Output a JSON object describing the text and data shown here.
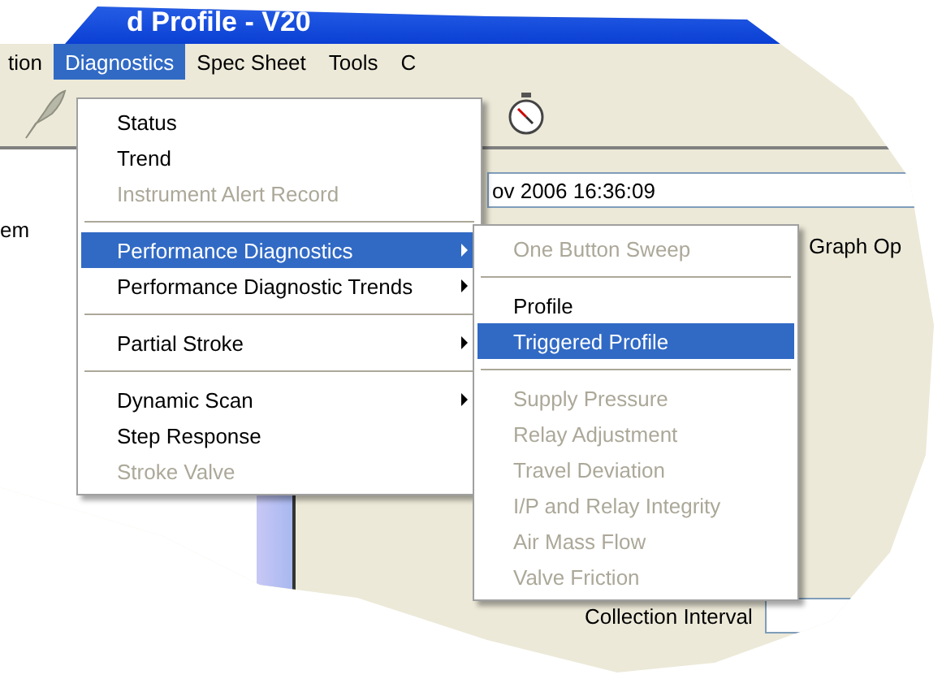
{
  "window": {
    "title": "d Profile - V20"
  },
  "menubar": [
    {
      "label": "tion",
      "selected": false
    },
    {
      "label": "Diagnostics",
      "selected": true
    },
    {
      "label": "Spec Sheet",
      "selected": false
    },
    {
      "label": "Tools",
      "selected": false
    },
    {
      "label": "C",
      "selected": false
    }
  ],
  "side_label": "em",
  "date_field": {
    "value": "ov 2006 16:36:09"
  },
  "graph_options": {
    "label": "Graph Op"
  },
  "collection_interval": {
    "label": "Collection Interval"
  },
  "menu": [
    {
      "kind": "item",
      "label": "Status",
      "disabled": false,
      "selected": false,
      "submenu": false
    },
    {
      "kind": "item",
      "label": "Trend",
      "disabled": false,
      "selected": false,
      "submenu": false
    },
    {
      "kind": "item",
      "label": "Instrument Alert Record",
      "disabled": true,
      "selected": false,
      "submenu": false
    },
    {
      "kind": "separator"
    },
    {
      "kind": "item",
      "label": "Performance Diagnostics",
      "disabled": false,
      "selected": true,
      "submenu": true
    },
    {
      "kind": "item",
      "label": "Performance Diagnostic Trends",
      "disabled": false,
      "selected": false,
      "submenu": true
    },
    {
      "kind": "separator"
    },
    {
      "kind": "item",
      "label": "Partial Stroke",
      "disabled": false,
      "selected": false,
      "submenu": true
    },
    {
      "kind": "separator"
    },
    {
      "kind": "item",
      "label": "Dynamic Scan",
      "disabled": false,
      "selected": false,
      "submenu": true
    },
    {
      "kind": "item",
      "label": "Step Response",
      "disabled": false,
      "selected": false,
      "submenu": false
    },
    {
      "kind": "item",
      "label": "Stroke Valve",
      "disabled": true,
      "selected": false,
      "submenu": false
    }
  ],
  "submenu": [
    {
      "kind": "item",
      "label": "One Button Sweep",
      "disabled": true,
      "selected": false
    },
    {
      "kind": "separator"
    },
    {
      "kind": "item",
      "label": "Profile",
      "disabled": false,
      "selected": false
    },
    {
      "kind": "item",
      "label": "Triggered Profile",
      "disabled": false,
      "selected": true
    },
    {
      "kind": "separator"
    },
    {
      "kind": "item",
      "label": "Supply Pressure",
      "disabled": true,
      "selected": false
    },
    {
      "kind": "item",
      "label": "Relay Adjustment",
      "disabled": true,
      "selected": false
    },
    {
      "kind": "item",
      "label": "Travel Deviation",
      "disabled": true,
      "selected": false
    },
    {
      "kind": "item",
      "label": "I/P and Relay Integrity",
      "disabled": true,
      "selected": false
    },
    {
      "kind": "item",
      "label": "Air Mass Flow",
      "disabled": true,
      "selected": false
    },
    {
      "kind": "item",
      "label": "Valve Friction",
      "disabled": true,
      "selected": false
    }
  ]
}
